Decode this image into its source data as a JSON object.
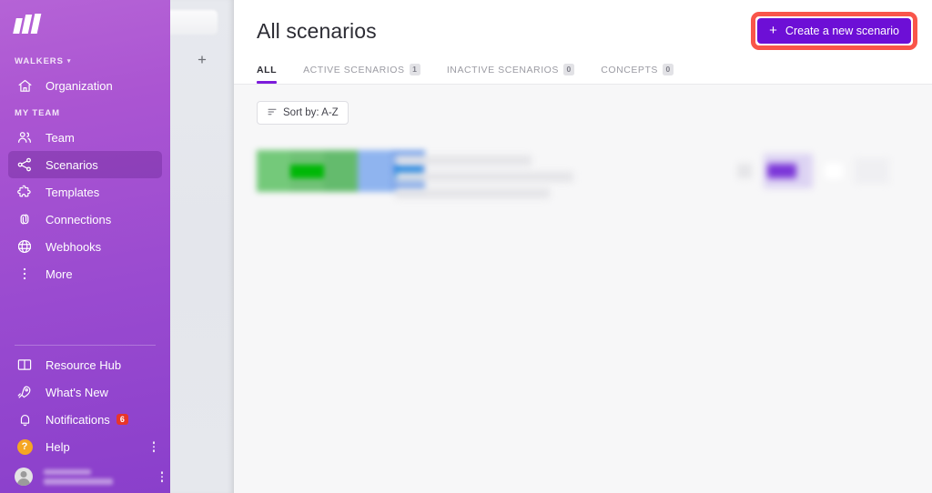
{
  "sidebar": {
    "logo_name": "make-logo",
    "org_section": {
      "label": "WALKERS",
      "caret": "▾"
    },
    "org_item": {
      "label": "Organization",
      "icon": "home-icon"
    },
    "team_section": {
      "label": "MY TEAM"
    },
    "items": [
      {
        "label": "Team",
        "icon": "team-icon",
        "selected": false
      },
      {
        "label": "Scenarios",
        "icon": "scenarios-icon",
        "selected": true
      },
      {
        "label": "Templates",
        "icon": "templates-icon",
        "selected": false
      },
      {
        "label": "Connections",
        "icon": "connections-icon",
        "selected": false
      },
      {
        "label": "Webhooks",
        "icon": "webhooks-icon",
        "selected": false
      },
      {
        "label": "More",
        "icon": "more-icon",
        "selected": false
      }
    ],
    "bottom_items": [
      {
        "label": "Resource Hub",
        "icon": "book-icon"
      },
      {
        "label": "What's New",
        "icon": "rocket-icon"
      },
      {
        "label": "Notifications",
        "icon": "bell-icon",
        "badge": "6"
      },
      {
        "label": "Help",
        "icon": "help-icon"
      }
    ],
    "user": {
      "name_redacted": "",
      "org_redacted": ""
    }
  },
  "header": {
    "title": "All scenarios",
    "create_button": {
      "label": "Create a new scenario",
      "plus": "+",
      "color": "#6d0fd6"
    },
    "highlight_color": "#f9554a"
  },
  "tabs": [
    {
      "label": "ALL",
      "badge": null,
      "active": true
    },
    {
      "label": "ACTIVE SCENARIOS",
      "badge": "1",
      "active": false
    },
    {
      "label": "INACTIVE SCENARIOS",
      "badge": "0",
      "active": false
    },
    {
      "label": "CONCEPTS",
      "badge": "0",
      "active": false
    }
  ],
  "toolbar": {
    "sort_label": "Sort by: A-Z",
    "sort_icon": "sort-lines-icon"
  },
  "scenario_row": {
    "redacted": true,
    "icon_colors": [
      "#74c97a",
      "#00b707",
      "#8fb4ef",
      "#0076e0"
    ],
    "toggle_color": "#7b35d8"
  },
  "panel2": {
    "plus_icon": "plus-icon"
  },
  "colors": {
    "sidebar_top": "#b563d6",
    "sidebar_bottom": "#8a3fcb",
    "accent_purple": "#7c1cdb",
    "main_bg": "#f7f7f8",
    "badge_red": "#e8352a",
    "help_orange": "#f5a623"
  }
}
